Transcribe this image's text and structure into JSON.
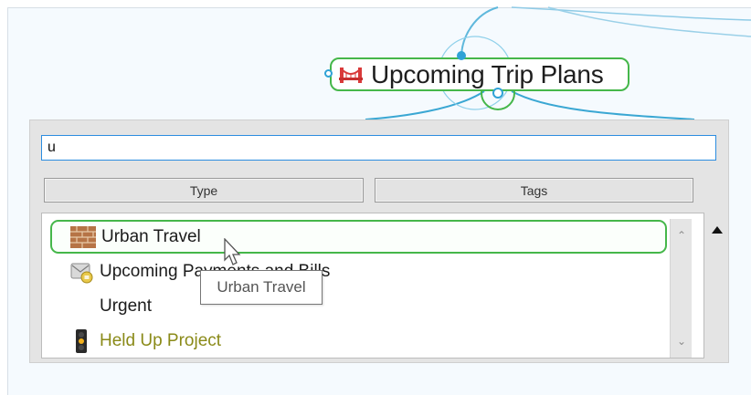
{
  "canvas": {
    "central_topic": {
      "label": "Upcoming Trip Plans",
      "icon": "bridge-icon"
    }
  },
  "search": {
    "value": "u",
    "placeholder": ""
  },
  "filters": {
    "type_label": "Type",
    "tags_label": "Tags"
  },
  "results": {
    "items": [
      {
        "label": "Urban Travel",
        "icon": "brick-wall-icon",
        "selected": true
      },
      {
        "label": "Upcoming Payments and Bills",
        "icon": "mail-icon",
        "selected": false
      },
      {
        "label": "Urgent",
        "icon": "",
        "selected": false
      },
      {
        "label": "Held Up Project",
        "icon": "traffic-light-icon",
        "selected": false
      }
    ]
  },
  "tooltip": {
    "text": "Urban Travel"
  },
  "colors": {
    "accent_green": "#45b74a",
    "focus_blue": "#2c8de0",
    "connector_blue": "#3aa7d3",
    "olive_text": "#8a8a18"
  }
}
